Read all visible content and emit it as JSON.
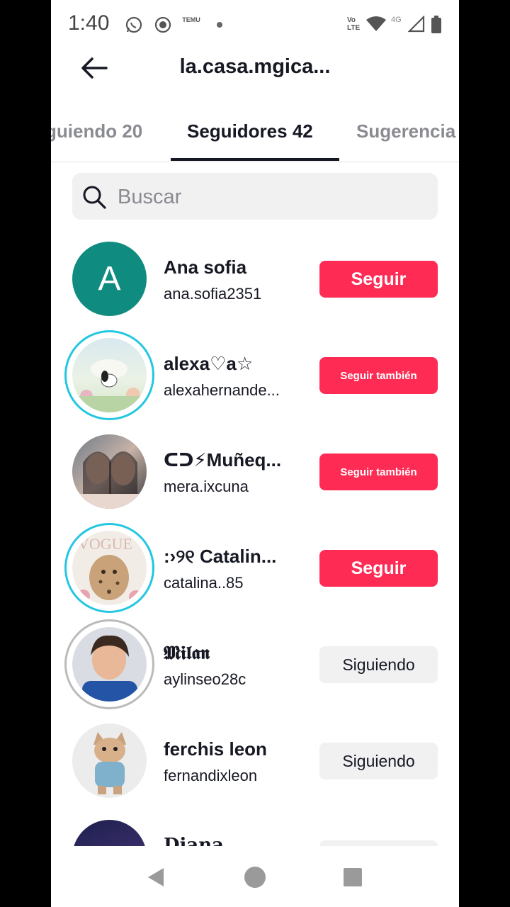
{
  "status_bar": {
    "time": "1:40",
    "temu_label": "TEMU",
    "volte_label": "Vo\nLTE",
    "network_label": "4G"
  },
  "header": {
    "title": "la.casa.mgica..."
  },
  "tabs": [
    {
      "label": "guiendo 20"
    },
    {
      "label": "Seguidores 42"
    },
    {
      "label": "Sugerencia"
    }
  ],
  "search": {
    "placeholder": "Buscar"
  },
  "users": [
    {
      "name": "Ana sofia",
      "handle": "ana.sofia2351",
      "button": "Seguir",
      "avatar_letter": "A"
    },
    {
      "name": "alexa♡a☆",
      "handle": "alexahernande...",
      "button": "Seguir también"
    },
    {
      "name": "ᑕᑐ⚡Muñeq...",
      "handle": "mera.ixcuna",
      "button": "Seguir también"
    },
    {
      "name": ":›୨୧ Catalin...",
      "handle": "catalina..85",
      "button": "Seguir"
    },
    {
      "name": "𝕸𝖎𝖑𝖆𝖓",
      "handle": "aylinseo28c",
      "button": "Siguiendo"
    },
    {
      "name": "ferchis leon",
      "handle": "fernandixleon",
      "button": "Siguiendo"
    },
    {
      "name": "Diana",
      "handle": "",
      "button": ""
    }
  ],
  "colors": {
    "accent": "#fe2c55",
    "ring": "#23c7e0",
    "avatar_teal": "#0f8c7f"
  }
}
